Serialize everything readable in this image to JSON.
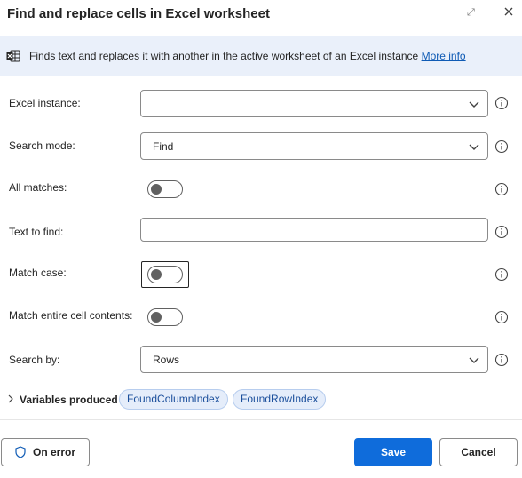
{
  "dialog": {
    "title": "Find and replace cells in Excel worksheet",
    "banner_text": "Finds text and replaces it with another in the active worksheet of an Excel instance",
    "more_info": "More info"
  },
  "fields": {
    "excel_instance": {
      "label": "Excel instance:",
      "value": ""
    },
    "search_mode": {
      "label": "Search mode:",
      "value": "Find"
    },
    "all_matches": {
      "label": "All matches:",
      "checked": false
    },
    "text_to_find": {
      "label": "Text to find:",
      "value": ""
    },
    "match_case": {
      "label": "Match case:",
      "checked": false
    },
    "match_entire": {
      "label": "Match entire cell contents:",
      "checked": false
    },
    "search_by": {
      "label": "Search by:",
      "value": "Rows"
    }
  },
  "variables": {
    "label": "Variables produced",
    "items": [
      "FoundColumnIndex",
      "FoundRowIndex"
    ]
  },
  "footer": {
    "on_error": "On error",
    "save": "Save",
    "cancel": "Cancel"
  },
  "colors": {
    "accent": "#0f6cdb",
    "banner_bg": "#eaf0fa",
    "chip_bg": "#e5edfa"
  }
}
